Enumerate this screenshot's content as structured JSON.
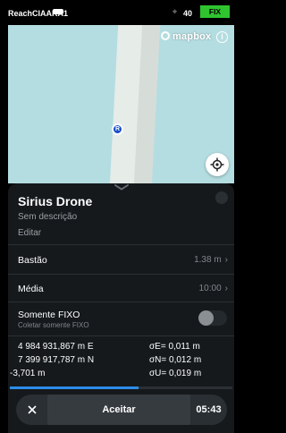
{
  "status_bar": {
    "device_name": "ReachCIAARA1",
    "satellite_count": "40",
    "fix_label": "FIX",
    "fix_color": "#2fc42f"
  },
  "map": {
    "attribution": "mapbox",
    "marker_label": "R",
    "marker_color": "#1a4fc9"
  },
  "sheet": {
    "title": "Sirius Drone",
    "description": "Sem descrição",
    "edit_label": "Editar",
    "rows": [
      {
        "label": "Bastão",
        "value": "1.38 m"
      },
      {
        "label": "Média",
        "value": "10:00"
      }
    ],
    "fixed_only": {
      "label": "Somente FIXO",
      "sublabel": "Coletar somente FIXO",
      "enabled": false
    },
    "coordinates": {
      "easting": "4 984 931,867 m E",
      "northing": "7 399 917,787 m N",
      "height": "-3,701 m",
      "sigma_e": "σE= 0,011 m",
      "sigma_n": "σN= 0,012 m",
      "sigma_u": "σU= 0,019 m"
    },
    "progress_fraction": 0.58,
    "progress_color": "#2d8ce8",
    "actions": {
      "cancel_icon": "close-icon",
      "accept_label": "Aceitar",
      "timer": "05:43"
    }
  }
}
